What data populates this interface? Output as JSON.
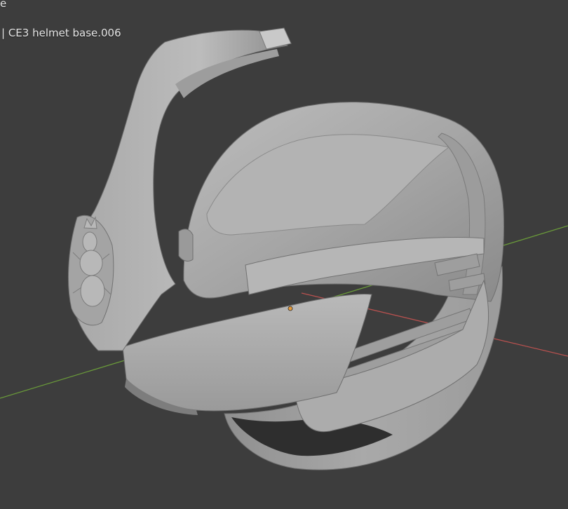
{
  "viewport": {
    "background": "#3d3d3d",
    "header_line1": "e",
    "header_line2": "| CE3 helmet base.006"
  },
  "scene": {
    "object": "CE3 helmet base.006",
    "axis_x_color": "#b8514f",
    "axis_y_color": "#6a9a3a",
    "mesh_color": "#a9a9a9",
    "origin_color": "#e69b3a"
  }
}
